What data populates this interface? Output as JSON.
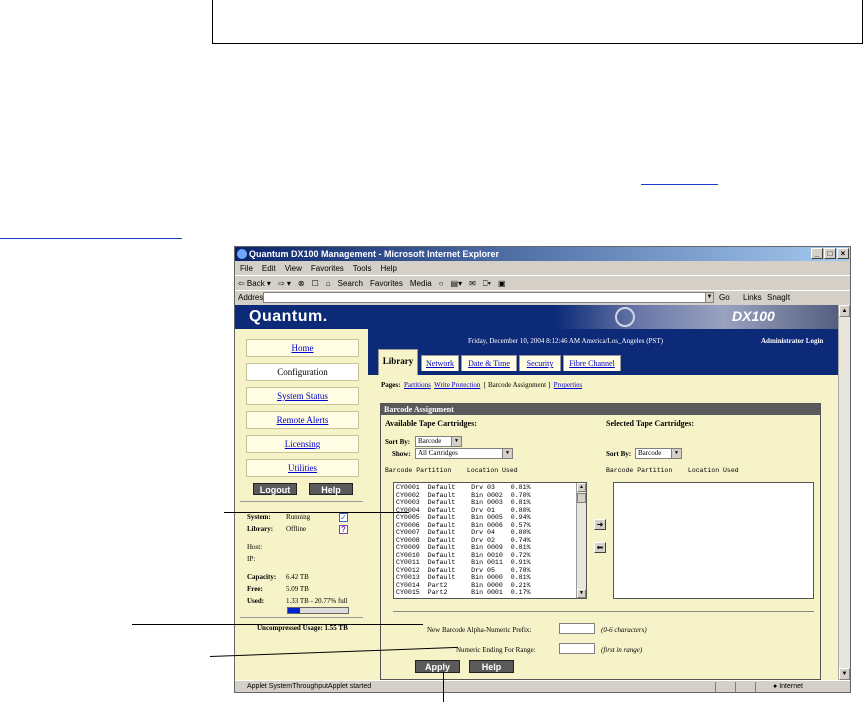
{
  "browser": {
    "title": "Quantum DX100 Management - Microsoft Internet Explorer",
    "window_buttons": [
      "_",
      "□",
      "×"
    ],
    "menu": [
      "File",
      "Edit",
      "View",
      "Favorites",
      "Tools",
      "Help"
    ],
    "toolbar": [
      "⇦ Back ▾",
      "⇨ ▾",
      "⊗",
      "☐",
      "⌂",
      "Search",
      "Favorites",
      "Media",
      "○",
      "▤▾",
      "✉",
      "⎕▾",
      "▣"
    ],
    "address_label": "Address",
    "go_label": "Go",
    "links_label": "Links",
    "snagit_label": "SnagIt",
    "status_text": "Applet SystemThroughputApplet started",
    "zone_text": "Internet"
  },
  "header": {
    "logo": "Quantum.",
    "model": "DX100"
  },
  "sidebar": {
    "nav": [
      {
        "label": "Home",
        "active": false
      },
      {
        "label": "Configuration",
        "active": true
      },
      {
        "label": "System Status",
        "active": false
      },
      {
        "label": "Remote Alerts",
        "active": false
      },
      {
        "label": "Licensing",
        "active": false
      },
      {
        "label": "Utilities",
        "active": false
      }
    ],
    "logout": "Logout",
    "help": "Help",
    "system_label": "System:",
    "system_value": "Running",
    "library_label": "Library:",
    "library_value": "Offline",
    "host_label": "Host:",
    "ip_label": "IP:",
    "capacity_label": "Capacity:",
    "capacity_value": "6.42 TB",
    "free_label": "Free:",
    "free_value": "5.09 TB",
    "used_label": "Used:",
    "used_value": "1.33 TB - 20.77% full",
    "used_fraction": 0.2077,
    "uncompressed": "Uncompressed Usage: 1.55 TB"
  },
  "main": {
    "datetime": "Friday, December 10, 2004 8:12:46 AM America/Los_Angeles (PST)",
    "admin": "Administrator Login",
    "tabs": [
      "Library",
      "Network",
      "Date & Time",
      "Security",
      "Fibre Channel"
    ],
    "pages_label": "Pages:",
    "pages": [
      "Partitions",
      "Write Protection",
      "[ Barcode Assignment ]",
      "Properties"
    ],
    "section_title": "Barcode Assignment",
    "available_title": "Available Tape Cartridges:",
    "selected_title": "Selected Tape Cartridges:",
    "sort_by_label": "Sort By:",
    "sort_by_value": "Barcode",
    "show_label": "Show:",
    "show_value": "All Cartridges",
    "columns": "Barcode Partition    Location Used",
    "cartridges": [
      "CY0001  Default    Drv 03    0.81%",
      "CY0002  Default    Bin 0002  0.70%",
      "CY0003  Default    Bin 0003  0.81%",
      "CY0004  Default    Drv 01    0.80%",
      "CY0005  Default    Bin 0005  0.94%",
      "CY0006  Default    Bin 0006  0.57%",
      "CY0007  Default    Drv 04    0.80%",
      "CY0008  Default    Drv 02    0.74%",
      "CY0009  Default    Bin 0009  0.81%",
      "CY0010  Default    Bin 0010  0.72%",
      "CY0011  Default    Bin 0011  0.91%",
      "CY0012  Default    Drv 05    0.78%",
      "CY0013  Default    Bin 0000  0.81%",
      "CY0014  Part2      Bin 0000  0.21%",
      "CY0015  Part2      Bin 0001  0.17%"
    ],
    "move_right": "➜",
    "move_left": "⬅",
    "prefix_label": "New Barcode Alpha-Numeric Prefix:",
    "prefix_value": "",
    "prefix_hint": "(0-6 characters)",
    "ending_label": "Numeric Ending For Range:",
    "ending_value": "",
    "ending_hint": "(first in range)",
    "apply": "Apply",
    "help": "Help"
  }
}
